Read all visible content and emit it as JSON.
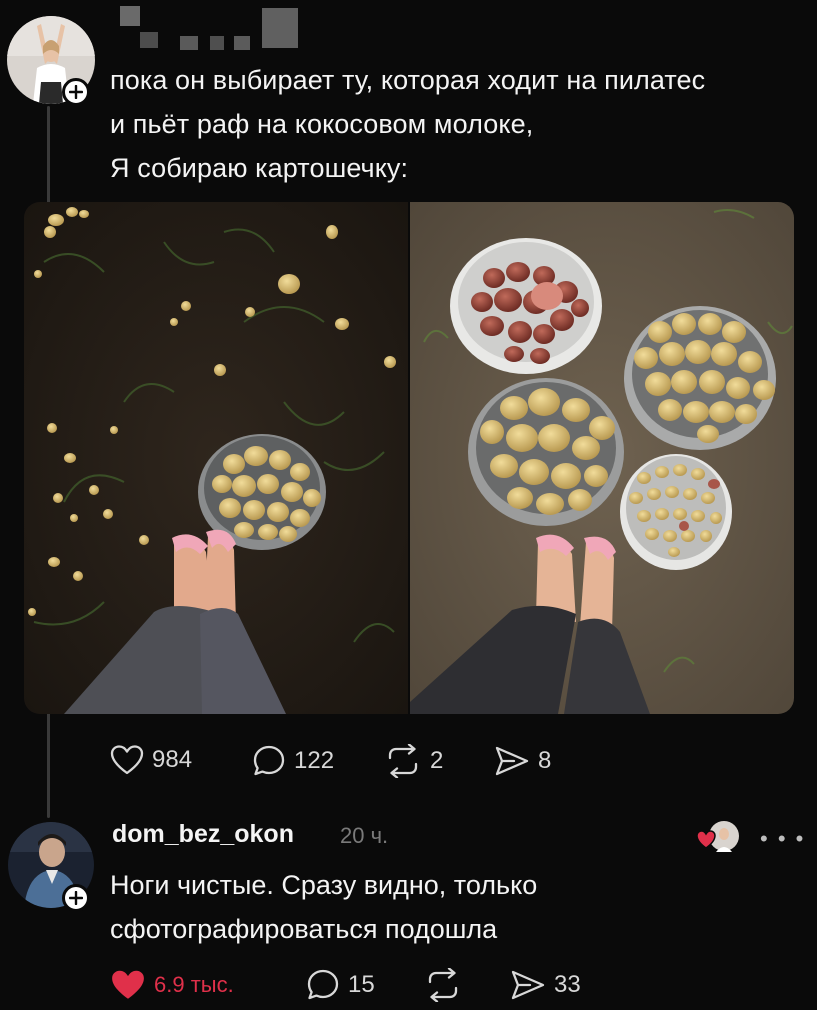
{
  "post": {
    "text_lines": [
      "пока он выбирает ту, которая ходит на пилатес",
      "и пьёт раф на кокосовом молоке,",
      "Я собираю картошечку:"
    ],
    "actions": {
      "likes": "984",
      "comments": "122",
      "reposts": "2",
      "shares": "8"
    }
  },
  "comment": {
    "username": "dom_bez_okon",
    "time": "20 ч.",
    "text_lines": [
      "Ноги чистые. Сразу видно, только",
      "сфотографироваться подошла"
    ],
    "more": "• • •",
    "actions": {
      "likes": "6.9 тыс.",
      "comments": "15",
      "shares": "33"
    }
  },
  "icons": {
    "like": "heart-icon",
    "comment": "speech-bubble-icon",
    "repost": "repost-icon",
    "share": "paper-plane-icon",
    "follow": "plus-icon",
    "more": "more-dots-icon"
  },
  "colors": {
    "background": "#0a0a0a",
    "text": "#f4f4f4",
    "muted": "#7a7a7a",
    "like_active": "#e0304a"
  }
}
